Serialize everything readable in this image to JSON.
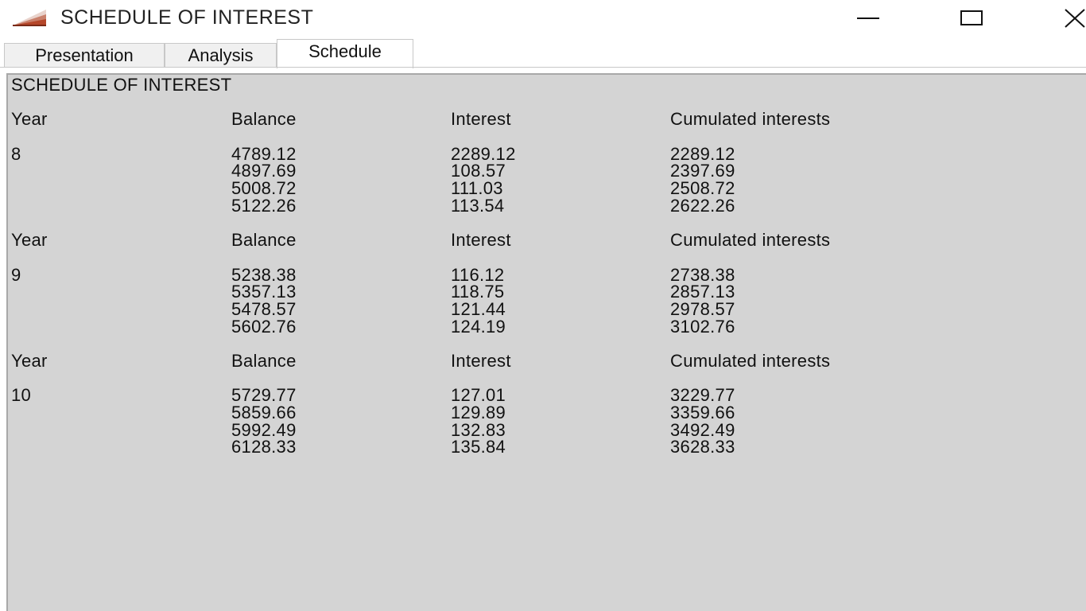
{
  "window": {
    "title": "SCHEDULE OF INTEREST",
    "icon": "chart-growth-icon",
    "controls": [
      "minimize-icon",
      "maximize-icon",
      "close-icon"
    ]
  },
  "tabs": [
    {
      "label": "Presentation",
      "active": false
    },
    {
      "label": "Analysis",
      "active": false
    },
    {
      "label": "Schedule",
      "active": true
    }
  ],
  "schedule": {
    "heading": "SCHEDULE OF INTEREST",
    "columns": [
      "Year",
      "Balance",
      "Interest",
      "Cumulated interests"
    ],
    "blocks": [
      {
        "year": "8",
        "rows": [
          {
            "balance": "4789.12",
            "interest": "2289.12",
            "cumulated": "2289.12"
          },
          {
            "balance": "4897.69",
            "interest": "108.57",
            "cumulated": "2397.69"
          },
          {
            "balance": "5008.72",
            "interest": "111.03",
            "cumulated": "2508.72"
          },
          {
            "balance": "5122.26",
            "interest": "113.54",
            "cumulated": "2622.26"
          }
        ]
      },
      {
        "year": "9",
        "rows": [
          {
            "balance": "5238.38",
            "interest": "116.12",
            "cumulated": "2738.38"
          },
          {
            "balance": "5357.13",
            "interest": "118.75",
            "cumulated": "2857.13"
          },
          {
            "balance": "5478.57",
            "interest": "121.44",
            "cumulated": "2978.57"
          },
          {
            "balance": "5602.76",
            "interest": "124.19",
            "cumulated": "3102.76"
          }
        ]
      },
      {
        "year": "10",
        "rows": [
          {
            "balance": "5729.77",
            "interest": "127.01",
            "cumulated": "3229.77"
          },
          {
            "balance": "5859.66",
            "interest": "129.89",
            "cumulated": "3359.66"
          },
          {
            "balance": "5992.49",
            "interest": "132.83",
            "cumulated": "3492.49"
          },
          {
            "balance": "6128.33",
            "interest": "135.84",
            "cumulated": "3628.33"
          }
        ]
      }
    ]
  },
  "colors": {
    "panel_bg": "#d4d4d4",
    "text": "#111111",
    "icon_accent": "#b5472a"
  }
}
